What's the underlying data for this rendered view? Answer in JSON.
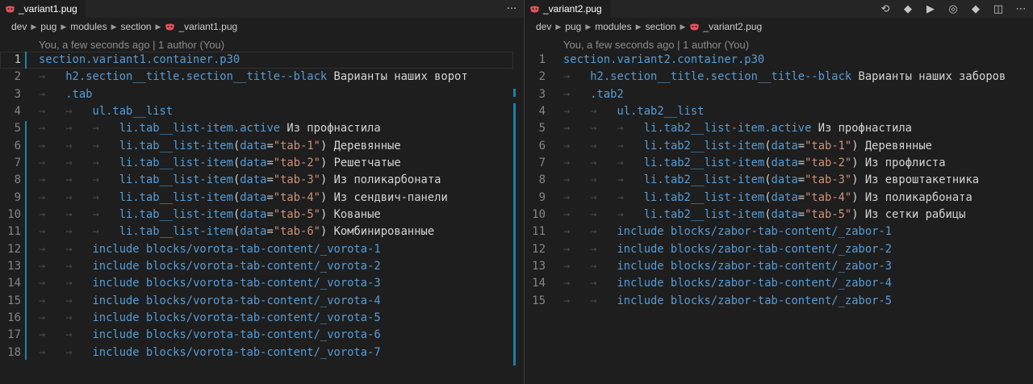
{
  "left": {
    "tab": {
      "title": "_variant1.pug"
    },
    "tab_actions": {
      "more": "···"
    },
    "breadcrumbs": [
      "dev",
      "pug",
      "modules",
      "section",
      "_variant1.pug"
    ],
    "blame": "You, a few seconds ago | 1 author (You)",
    "lines": [
      {
        "n": "1",
        "ind": 0,
        "segs": [
          {
            "t": "section",
            "c": "tag"
          },
          {
            "t": ".variant1.container.p30",
            "c": "tag"
          }
        ]
      },
      {
        "n": "2",
        "ind": 1,
        "segs": [
          {
            "t": "h2",
            "c": "tag"
          },
          {
            "t": ".section__title.section__title--black",
            "c": "tag"
          },
          {
            "t": " Варианты наших ворот",
            "c": "pl"
          }
        ]
      },
      {
        "n": "3",
        "ind": 1,
        "segs": [
          {
            "t": ".tab",
            "c": "tag"
          }
        ]
      },
      {
        "n": "4",
        "ind": 2,
        "segs": [
          {
            "t": "ul",
            "c": "tag"
          },
          {
            "t": ".tab__list",
            "c": "tag"
          }
        ]
      },
      {
        "n": "5",
        "ind": 3,
        "segs": [
          {
            "t": "li",
            "c": "tag"
          },
          {
            "t": ".tab__list-item.active",
            "c": "tag"
          },
          {
            "t": " Из профнастила",
            "c": "pl"
          }
        ]
      },
      {
        "n": "6",
        "ind": 3,
        "segs": [
          {
            "t": "li",
            "c": "tag"
          },
          {
            "t": ".tab__list-item",
            "c": "tag"
          },
          {
            "t": "(",
            "c": "pl"
          },
          {
            "t": "data",
            "c": "tag"
          },
          {
            "t": "=",
            "c": "pl"
          },
          {
            "t": "\"tab-1\"",
            "c": "str"
          },
          {
            "t": ") Деревянные",
            "c": "pl"
          }
        ]
      },
      {
        "n": "7",
        "ind": 3,
        "segs": [
          {
            "t": "li",
            "c": "tag"
          },
          {
            "t": ".tab__list-item",
            "c": "tag"
          },
          {
            "t": "(",
            "c": "pl"
          },
          {
            "t": "data",
            "c": "tag"
          },
          {
            "t": "=",
            "c": "pl"
          },
          {
            "t": "\"tab-2\"",
            "c": "str"
          },
          {
            "t": ") Решетчатые",
            "c": "pl"
          }
        ]
      },
      {
        "n": "8",
        "ind": 3,
        "segs": [
          {
            "t": "li",
            "c": "tag"
          },
          {
            "t": ".tab__list-item",
            "c": "tag"
          },
          {
            "t": "(",
            "c": "pl"
          },
          {
            "t": "data",
            "c": "tag"
          },
          {
            "t": "=",
            "c": "pl"
          },
          {
            "t": "\"tab-3\"",
            "c": "str"
          },
          {
            "t": ") Из поликарбоната",
            "c": "pl"
          }
        ]
      },
      {
        "n": "9",
        "ind": 3,
        "segs": [
          {
            "t": "li",
            "c": "tag"
          },
          {
            "t": ".tab__list-item",
            "c": "tag"
          },
          {
            "t": "(",
            "c": "pl"
          },
          {
            "t": "data",
            "c": "tag"
          },
          {
            "t": "=",
            "c": "pl"
          },
          {
            "t": "\"tab-4\"",
            "c": "str"
          },
          {
            "t": ") Из сендвич-панели",
            "c": "pl"
          }
        ]
      },
      {
        "n": "10",
        "ind": 3,
        "segs": [
          {
            "t": "li",
            "c": "tag"
          },
          {
            "t": ".tab__list-item",
            "c": "tag"
          },
          {
            "t": "(",
            "c": "pl"
          },
          {
            "t": "data",
            "c": "tag"
          },
          {
            "t": "=",
            "c": "pl"
          },
          {
            "t": "\"tab-5\"",
            "c": "str"
          },
          {
            "t": ") Кованые",
            "c": "pl"
          }
        ]
      },
      {
        "n": "11",
        "ind": 3,
        "segs": [
          {
            "t": "li",
            "c": "tag"
          },
          {
            "t": ".tab__list-item",
            "c": "tag"
          },
          {
            "t": "(",
            "c": "pl"
          },
          {
            "t": "data",
            "c": "tag"
          },
          {
            "t": "=",
            "c": "pl"
          },
          {
            "t": "\"tab-6\"",
            "c": "str"
          },
          {
            "t": ") Комбинированные",
            "c": "pl"
          }
        ]
      },
      {
        "n": "12",
        "ind": 2,
        "segs": [
          {
            "t": "include",
            "c": "tag"
          },
          {
            "t": " blocks/vorota-tab-content/_vorota-1",
            "c": "tag"
          }
        ]
      },
      {
        "n": "13",
        "ind": 2,
        "segs": [
          {
            "t": "include",
            "c": "tag"
          },
          {
            "t": " blocks/vorota-tab-content/_vorota-2",
            "c": "tag"
          }
        ]
      },
      {
        "n": "14",
        "ind": 2,
        "segs": [
          {
            "t": "include",
            "c": "tag"
          },
          {
            "t": " blocks/vorota-tab-content/_vorota-3",
            "c": "tag"
          }
        ]
      },
      {
        "n": "15",
        "ind": 2,
        "segs": [
          {
            "t": "include",
            "c": "tag"
          },
          {
            "t": " blocks/vorota-tab-content/_vorota-4",
            "c": "tag"
          }
        ]
      },
      {
        "n": "16",
        "ind": 2,
        "segs": [
          {
            "t": "include",
            "c": "tag"
          },
          {
            "t": " blocks/vorota-tab-content/_vorota-5",
            "c": "tag"
          }
        ]
      },
      {
        "n": "17",
        "ind": 2,
        "segs": [
          {
            "t": "include",
            "c": "tag"
          },
          {
            "t": " blocks/vorota-tab-content/_vorota-6",
            "c": "tag"
          }
        ]
      },
      {
        "n": "18",
        "ind": 2,
        "segs": [
          {
            "t": "include",
            "c": "tag"
          },
          {
            "t": " blocks/vorota-tab-content/_vorota-7",
            "c": "tag"
          }
        ]
      }
    ]
  },
  "right": {
    "tab": {
      "title": "_variant2.pug"
    },
    "tab_actions": [
      "compare-icon",
      "git-icon",
      "run-icon",
      "preview-icon",
      "source-control-icon",
      "split-icon",
      "more-icon"
    ],
    "breadcrumbs": [
      "dev",
      "pug",
      "modules",
      "section",
      "_variant2.pug"
    ],
    "blame": "You, a few seconds ago | 1 author (You)",
    "lines": [
      {
        "n": "1",
        "ind": 0,
        "segs": [
          {
            "t": "section",
            "c": "tag"
          },
          {
            "t": ".variant2.container.p30",
            "c": "tag"
          }
        ]
      },
      {
        "n": "2",
        "ind": 1,
        "segs": [
          {
            "t": "h2",
            "c": "tag"
          },
          {
            "t": ".section__title.section__title--black",
            "c": "tag"
          },
          {
            "t": " Варианты наших заборов",
            "c": "pl"
          }
        ]
      },
      {
        "n": "3",
        "ind": 1,
        "segs": [
          {
            "t": ".tab2",
            "c": "tag"
          }
        ]
      },
      {
        "n": "4",
        "ind": 2,
        "segs": [
          {
            "t": "ul",
            "c": "tag"
          },
          {
            "t": ".tab2__list",
            "c": "tag"
          }
        ]
      },
      {
        "n": "5",
        "ind": 3,
        "segs": [
          {
            "t": "li",
            "c": "tag"
          },
          {
            "t": ".tab2__list-item.active",
            "c": "tag"
          },
          {
            "t": " Из профнастила",
            "c": "pl"
          }
        ]
      },
      {
        "n": "6",
        "ind": 3,
        "segs": [
          {
            "t": "li",
            "c": "tag"
          },
          {
            "t": ".tab2__list-item",
            "c": "tag"
          },
          {
            "t": "(",
            "c": "pl"
          },
          {
            "t": "data",
            "c": "tag"
          },
          {
            "t": "=",
            "c": "pl"
          },
          {
            "t": "\"tab-1\"",
            "c": "str"
          },
          {
            "t": ") Деревянные",
            "c": "pl"
          }
        ]
      },
      {
        "n": "7",
        "ind": 3,
        "segs": [
          {
            "t": "li",
            "c": "tag"
          },
          {
            "t": ".tab2__list-item",
            "c": "tag"
          },
          {
            "t": "(",
            "c": "pl"
          },
          {
            "t": "data",
            "c": "tag"
          },
          {
            "t": "=",
            "c": "pl"
          },
          {
            "t": "\"tab-2\"",
            "c": "str"
          },
          {
            "t": ") Из профлиста",
            "c": "pl"
          }
        ]
      },
      {
        "n": "8",
        "ind": 3,
        "segs": [
          {
            "t": "li",
            "c": "tag"
          },
          {
            "t": ".tab2__list-item",
            "c": "tag"
          },
          {
            "t": "(",
            "c": "pl"
          },
          {
            "t": "data",
            "c": "tag"
          },
          {
            "t": "=",
            "c": "pl"
          },
          {
            "t": "\"tab-3\"",
            "c": "str"
          },
          {
            "t": ") Из евроштакетника",
            "c": "pl"
          }
        ]
      },
      {
        "n": "9",
        "ind": 3,
        "segs": [
          {
            "t": "li",
            "c": "tag"
          },
          {
            "t": ".tab2__list-item",
            "c": "tag"
          },
          {
            "t": "(",
            "c": "pl"
          },
          {
            "t": "data",
            "c": "tag"
          },
          {
            "t": "=",
            "c": "pl"
          },
          {
            "t": "\"tab-4\"",
            "c": "str"
          },
          {
            "t": ") Из поликарбоната",
            "c": "pl"
          }
        ]
      },
      {
        "n": "10",
        "ind": 3,
        "segs": [
          {
            "t": "li",
            "c": "tag"
          },
          {
            "t": ".tab2__list-item",
            "c": "tag"
          },
          {
            "t": "(",
            "c": "pl"
          },
          {
            "t": "data",
            "c": "tag"
          },
          {
            "t": "=",
            "c": "pl"
          },
          {
            "t": "\"tab-5\"",
            "c": "str"
          },
          {
            "t": ") Из сетки рабицы",
            "c": "pl"
          }
        ]
      },
      {
        "n": "11",
        "ind": 2,
        "segs": [
          {
            "t": "include",
            "c": "tag"
          },
          {
            "t": " blocks/zabor-tab-content/_zabor-1",
            "c": "tag"
          }
        ]
      },
      {
        "n": "12",
        "ind": 2,
        "segs": [
          {
            "t": "include",
            "c": "tag"
          },
          {
            "t": " blocks/zabor-tab-content/_zabor-2",
            "c": "tag"
          }
        ]
      },
      {
        "n": "13",
        "ind": 2,
        "segs": [
          {
            "t": "include",
            "c": "tag"
          },
          {
            "t": " blocks/zabor-tab-content/_zabor-3",
            "c": "tag"
          }
        ]
      },
      {
        "n": "14",
        "ind": 2,
        "segs": [
          {
            "t": "include",
            "c": "tag"
          },
          {
            "t": " blocks/zabor-tab-content/_zabor-4",
            "c": "tag"
          }
        ]
      },
      {
        "n": "15",
        "ind": 2,
        "segs": [
          {
            "t": "include",
            "c": "tag"
          },
          {
            "t": " blocks/zabor-tab-content/_zabor-5",
            "c": "tag"
          }
        ]
      }
    ]
  },
  "colors": {
    "background": "#1e1e1e",
    "keyword": "#569cd6",
    "plain_text": "#d4d4d4",
    "string": "#ce9178",
    "line_number": "#858585",
    "git_change_bar": "#1b81a8",
    "pug_icon": "#e0525c"
  }
}
